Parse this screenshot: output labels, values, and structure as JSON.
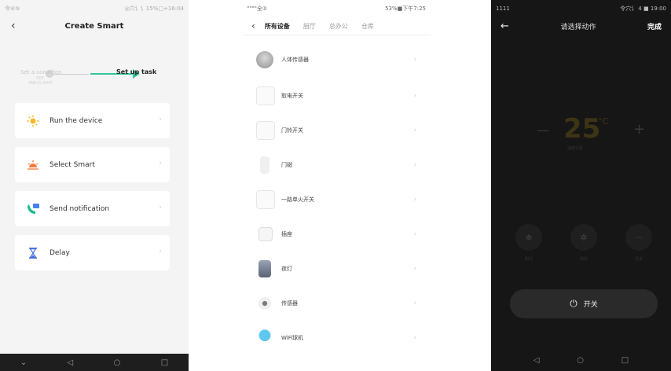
{
  "phone1": {
    "status_left": "令④⑤",
    "status_right": "◎穴讠讠15%□+16:04",
    "title": "Create Smart",
    "step1_label": "Set a condition",
    "step1_sub_a": "EEE",
    "step1_sub_b": "ANEUS BAPI",
    "step2_label": "Set up task",
    "items": [
      {
        "label": "Run the device",
        "icon": "sun-icon"
      },
      {
        "label": "Select Smart",
        "icon": "sunrise-icon"
      },
      {
        "label": "Send notification",
        "icon": "message-icon"
      },
      {
        "label": "Delay",
        "icon": "hourglass-icon"
      }
    ],
    "nav": [
      "⌄",
      "◁",
      "○",
      "□"
    ],
    "colors": {
      "accent": "#33c69a",
      "background": "#f4f4f4"
    }
  },
  "phone2": {
    "status_left": "\"\"\"\"全①",
    "status_right": "53%■下午7:25",
    "tabs": [
      "所有设备",
      "厨厅",
      "总办公",
      "仓库"
    ],
    "devices": [
      {
        "name": "人体传感器",
        "icon": "motion-sensor-icon"
      },
      {
        "name": "取电开关",
        "icon": "power-switch-icon"
      },
      {
        "name": "门铃开关",
        "icon": "door-switch-icon"
      },
      {
        "name": "门磁",
        "icon": "door-sensor-icon"
      },
      {
        "name": "一路单火开关",
        "icon": "single-switch-icon"
      },
      {
        "name": "插座",
        "icon": "socket-icon"
      },
      {
        "name": "夜灯",
        "icon": "night-light-icon"
      },
      {
        "name": "传感器",
        "icon": "sensor-icon"
      },
      {
        "name": "WiFi球机",
        "icon": "wifi-camera-icon"
      }
    ]
  },
  "phone3": {
    "status_left": "1111",
    "status_right": "令穴讠 4 ■ 19:00",
    "title": "请选择动作",
    "done": "完成",
    "temp_value": "25",
    "temp_unit": "°C",
    "temp_sub": "温度设置",
    "modes": [
      {
        "label": "制冷",
        "icon": "snowflake-icon"
      },
      {
        "label": "制热",
        "icon": "sun-icon"
      },
      {
        "label": "更多",
        "icon": "more-icon"
      }
    ],
    "power_label": "开关",
    "nav": [
      "◁",
      "○",
      "□"
    ]
  }
}
